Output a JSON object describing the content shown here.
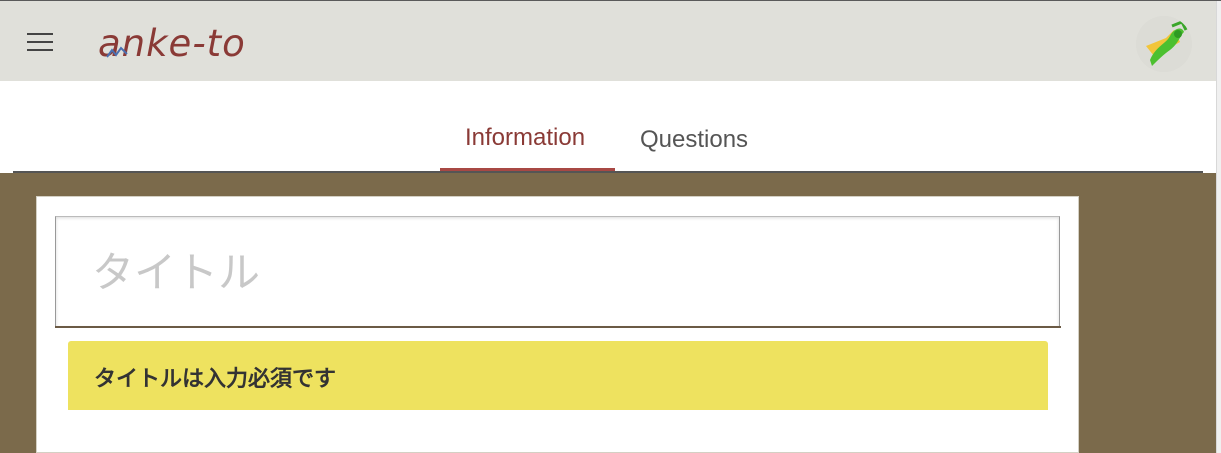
{
  "app": {
    "logo_text": "anke-to"
  },
  "tabs": [
    {
      "label": "Information",
      "active": true
    },
    {
      "label": "Questions",
      "active": false
    }
  ],
  "form": {
    "title_placeholder": "タイトル",
    "title_value": ""
  },
  "alert": {
    "message": "タイトルは入力必須です",
    "color": "#eee25f"
  },
  "colors": {
    "accent": "#8a3a36",
    "appbar": "#e0e0da",
    "content_bg": "#7b6a4b"
  },
  "icons": {
    "menu": "hamburger-menu-icon",
    "avatar": "user-avatar"
  }
}
